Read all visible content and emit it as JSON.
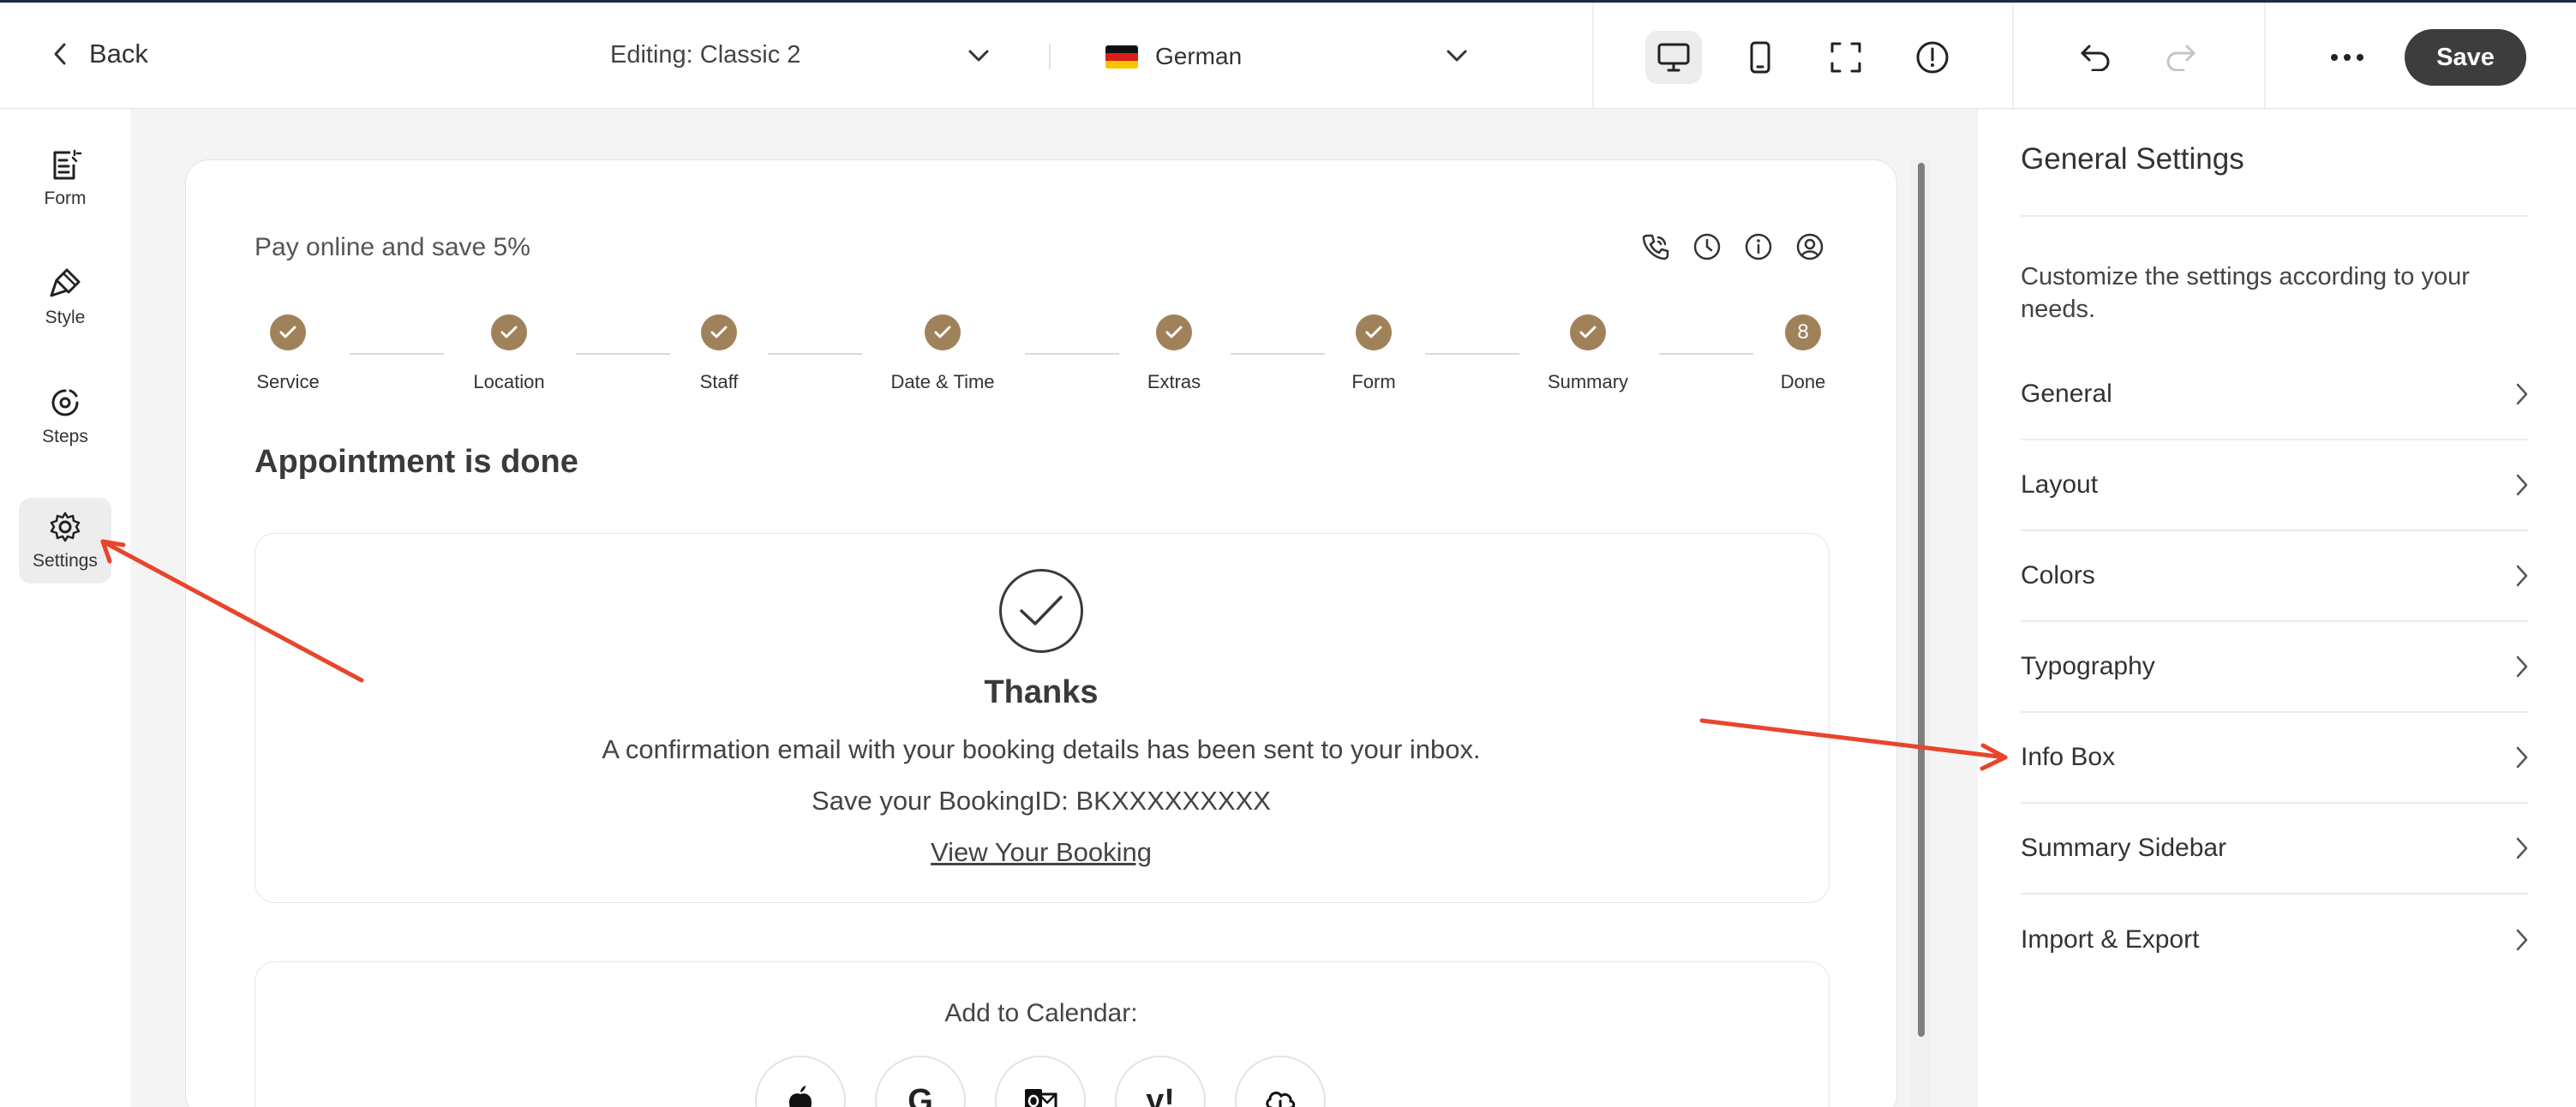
{
  "topbar": {
    "back_label": "Back",
    "editing_label": "Editing: Classic 2",
    "language": "German",
    "save_label": "Save"
  },
  "leftrail": {
    "items": [
      {
        "label": "Form",
        "icon": "form-icon"
      },
      {
        "label": "Style",
        "icon": "brush-icon"
      },
      {
        "label": "Steps",
        "icon": "steps-icon"
      },
      {
        "label": "Settings",
        "icon": "gear-icon",
        "active": true
      }
    ]
  },
  "form_preview": {
    "promo": "Pay online and save 5%",
    "steps": [
      {
        "label": "Service",
        "state": "done"
      },
      {
        "label": "Location",
        "state": "done"
      },
      {
        "label": "Staff",
        "state": "done"
      },
      {
        "label": "Date & Time",
        "state": "done"
      },
      {
        "label": "Extras",
        "state": "done"
      },
      {
        "label": "Form",
        "state": "done"
      },
      {
        "label": "Summary",
        "state": "done"
      },
      {
        "label": "Done",
        "state": "current",
        "number": "8"
      }
    ],
    "title": "Appointment is done",
    "thanks": "Thanks",
    "confirmation": "A confirmation email with your booking details has been sent to your inbox.",
    "booking_id": "Save your BookingID: BKXXXXXXXXX",
    "view_booking": "View Your Booking",
    "calendar_title": "Add to Calendar:",
    "calendar_buttons": [
      "apple-icon",
      "google-icon",
      "outlook-icon",
      "yahoo-icon",
      "ics-download-icon"
    ]
  },
  "general_settings": {
    "title": "General Settings",
    "description": "Customize the settings according to your needs.",
    "items": [
      "General",
      "Layout",
      "Colors",
      "Typography",
      "Info Box",
      "Summary Sidebar",
      "Import & Export"
    ]
  },
  "colors": {
    "accent": "#a0825a",
    "annotation": "#e8452c",
    "save_bg": "#3d3d3d"
  }
}
